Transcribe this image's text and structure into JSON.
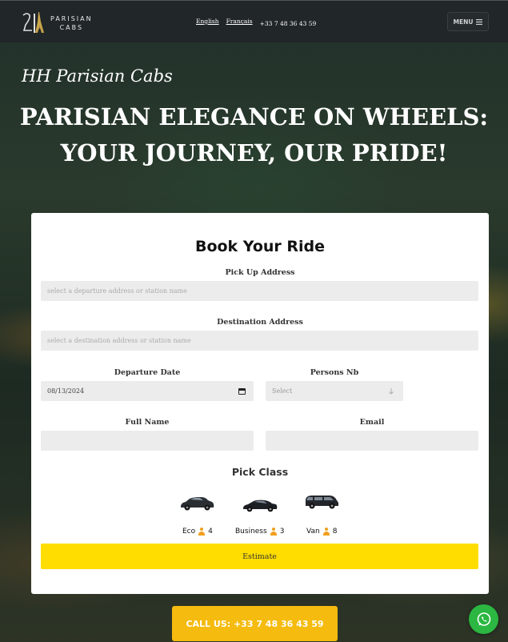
{
  "header": {
    "logo_top": "PARISIAN",
    "logo_bottom": "CABS",
    "lang_en": "English",
    "lang_fr": "Français",
    "phone": "+33 7 48 36 43 59",
    "menu_label": "MENU"
  },
  "hero": {
    "brand": "HH Parisian Cabs",
    "headline_1": "PARISIAN ELEGANCE ON WHEELS:",
    "headline_2": "YOUR JOURNEY, OUR PRIDE!"
  },
  "form": {
    "title": "Book Your Ride",
    "pickup_label": "Pick Up Address",
    "pickup_placeholder": "select a departure address or station name",
    "destination_label": "Destination Address",
    "destination_placeholder": "select a destination address or station name",
    "date_label": "Departure Date",
    "date_value": "08/13/2024",
    "persons_label": "Persons Nb",
    "persons_value": "Select",
    "fullname_label": "Full Name",
    "email_label": "Email",
    "pick_class_label": "Pick Class",
    "classes": [
      {
        "name": "Eco",
        "capacity": "4"
      },
      {
        "name": "Business",
        "capacity": "3"
      },
      {
        "name": "Van",
        "capacity": "8"
      }
    ],
    "estimate_label": "Estimate"
  },
  "footer": {
    "call_label": "CALL US: +33 7 48 36 43 59"
  },
  "colors": {
    "accent_yellow": "#ffdd00",
    "call_orange": "#f5bb0e",
    "whatsapp_green": "#2bb741",
    "topbar": "#212628"
  }
}
